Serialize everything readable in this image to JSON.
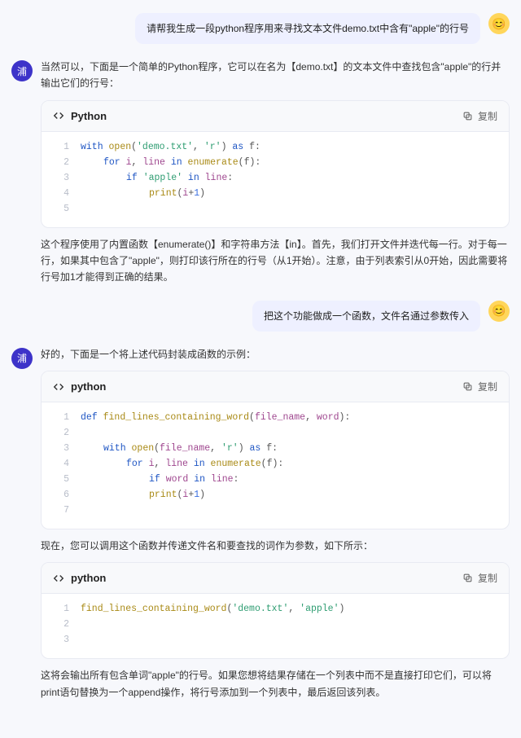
{
  "avatars": {
    "user_emoji": "😊",
    "bot_label": "浦"
  },
  "messages": {
    "u1": "请帮我生成一段python程序用来寻找文本文件demo.txt中含有\"apple\"的行号",
    "u2": "把这个功能做成一个函数，文件名通过参数传入"
  },
  "bot1": {
    "intro": "当然可以，下面是一个简单的Python程序，它可以在名为【demo.txt】的文本文件中查找包含\"apple\"的行并输出它们的行号：",
    "outro": "这个程序使用了内置函数【enumerate()】和字符串方法【in】。首先，我们打开文件并迭代每一行。对于每一行，如果其中包含了\"apple\"，则打印该行所在的行号（从1开始）。注意，由于列表索引从0开始，因此需要将行号加1才能得到正确的结果。",
    "code": {
      "lang": "Python",
      "copy": "复制",
      "lines": [
        [
          {
            "t": "with ",
            "c": "kw"
          },
          {
            "t": "open",
            "c": "fn"
          },
          {
            "t": "(",
            "c": "pl"
          },
          {
            "t": "'demo.txt'",
            "c": "str"
          },
          {
            "t": ", ",
            "c": "pl"
          },
          {
            "t": "'r'",
            "c": "str"
          },
          {
            "t": ") ",
            "c": "pl"
          },
          {
            "t": "as",
            "c": "kw"
          },
          {
            "t": " f:",
            "c": "pl"
          }
        ],
        [
          {
            "ind": 1
          },
          {
            "t": "for ",
            "c": "kw"
          },
          {
            "t": "i",
            "c": "id"
          },
          {
            "t": ", ",
            "c": "pl"
          },
          {
            "t": "line",
            "c": "id"
          },
          {
            "t": " in ",
            "c": "kw"
          },
          {
            "t": "enumerate",
            "c": "fn"
          },
          {
            "t": "(f):",
            "c": "pl"
          }
        ],
        [
          {
            "ind": 2
          },
          {
            "t": "if ",
            "c": "kw"
          },
          {
            "t": "'apple'",
            "c": "str"
          },
          {
            "t": " in ",
            "c": "kw"
          },
          {
            "t": "line",
            "c": "id"
          },
          {
            "t": ":",
            "c": "pl"
          }
        ],
        [
          {
            "ind": 3
          },
          {
            "t": "print",
            "c": "fn"
          },
          {
            "t": "(",
            "c": "pl"
          },
          {
            "t": "i",
            "c": "id"
          },
          {
            "t": "+",
            "c": "pl"
          },
          {
            "t": "1",
            "c": "num"
          },
          {
            "t": ")",
            "c": "pl"
          }
        ],
        []
      ]
    }
  },
  "bot2": {
    "intro": "好的，下面是一个将上述代码封装成函数的示例：",
    "mid": "现在，您可以调用这个函数并传递文件名和要查找的词作为参数，如下所示：",
    "outro": "这将会输出所有包含单词\"apple\"的行号。如果您想将结果存储在一个列表中而不是直接打印它们，可以将print语句替换为一个append操作，将行号添加到一个列表中，最后返回该列表。",
    "code1": {
      "lang": "python",
      "copy": "复制",
      "lines": [
        [
          {
            "t": "def ",
            "c": "kw"
          },
          {
            "t": "find_lines_containing_word",
            "c": "fn"
          },
          {
            "t": "(",
            "c": "pl"
          },
          {
            "t": "file_name",
            "c": "id"
          },
          {
            "t": ", ",
            "c": "pl"
          },
          {
            "t": "word",
            "c": "id"
          },
          {
            "t": "):",
            "c": "pl"
          }
        ],
        [],
        [
          {
            "ind": 1
          },
          {
            "t": "with ",
            "c": "kw"
          },
          {
            "t": "open",
            "c": "fn"
          },
          {
            "t": "(",
            "c": "pl"
          },
          {
            "t": "file_name",
            "c": "id"
          },
          {
            "t": ", ",
            "c": "pl"
          },
          {
            "t": "'r'",
            "c": "str"
          },
          {
            "t": ") ",
            "c": "pl"
          },
          {
            "t": "as",
            "c": "kw"
          },
          {
            "t": " f:",
            "c": "pl"
          }
        ],
        [
          {
            "ind": 2
          },
          {
            "t": "for ",
            "c": "kw"
          },
          {
            "t": "i",
            "c": "id"
          },
          {
            "t": ", ",
            "c": "pl"
          },
          {
            "t": "line",
            "c": "id"
          },
          {
            "t": " in ",
            "c": "kw"
          },
          {
            "t": "enumerate",
            "c": "fn"
          },
          {
            "t": "(f):",
            "c": "pl"
          }
        ],
        [
          {
            "ind": 3
          },
          {
            "t": "if ",
            "c": "kw"
          },
          {
            "t": "word",
            "c": "id"
          },
          {
            "t": " in ",
            "c": "kw"
          },
          {
            "t": "line",
            "c": "id"
          },
          {
            "t": ":",
            "c": "pl"
          }
        ],
        [
          {
            "ind": 3
          },
          {
            "t": "    ",
            "c": "pl"
          },
          {
            "t": "print",
            "c": "fn"
          },
          {
            "t": "(",
            "c": "pl"
          },
          {
            "t": "i",
            "c": "id"
          },
          {
            "t": "+",
            "c": "pl"
          },
          {
            "t": "1",
            "c": "num"
          },
          {
            "t": ")",
            "c": "pl"
          }
        ],
        []
      ]
    },
    "code2": {
      "lang": "python",
      "copy": "复制",
      "lines": [
        [
          {
            "t": "find_lines_containing_word",
            "c": "fn"
          },
          {
            "t": "(",
            "c": "pl"
          },
          {
            "t": "'demo.txt'",
            "c": "str"
          },
          {
            "t": ", ",
            "c": "pl"
          },
          {
            "t": "'apple'",
            "c": "str"
          },
          {
            "t": ")",
            "c": "pl"
          }
        ],
        [],
        []
      ]
    }
  }
}
